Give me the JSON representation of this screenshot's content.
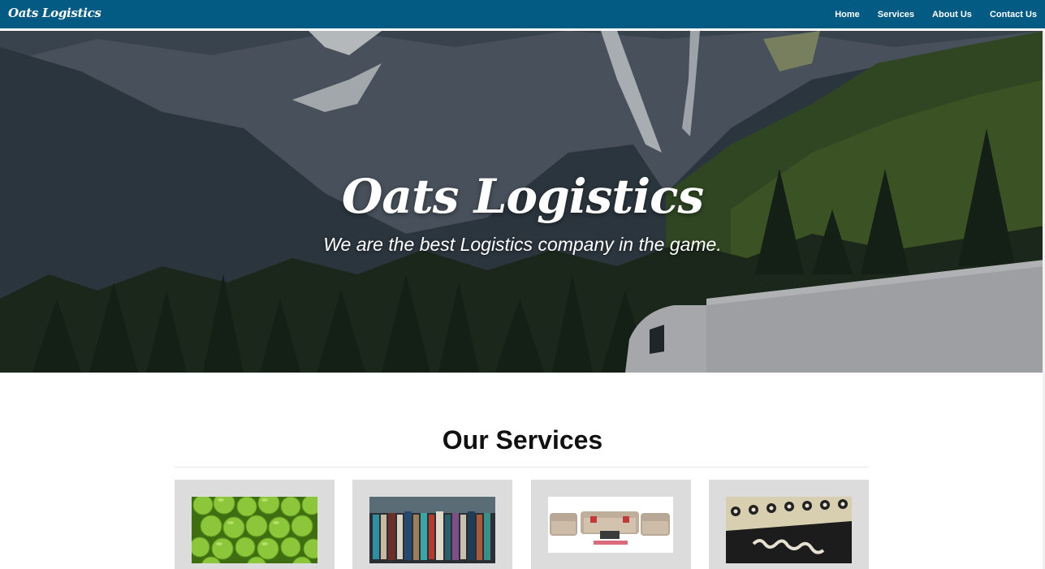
{
  "navbar": {
    "brand": "Oats Logistics",
    "links": [
      "Home",
      "Services",
      "About Us",
      "Contact Us"
    ],
    "background": "#035a82"
  },
  "hero": {
    "title": "Oats Logistics",
    "subtitle": "We are the best Logistics company in the game."
  },
  "services": {
    "title": "Our Services",
    "cards": [
      {
        "image": "green-apples-image"
      },
      {
        "image": "books-image"
      },
      {
        "image": "sofa-furniture-image"
      },
      {
        "image": "marshall-amplifier-image"
      }
    ]
  }
}
